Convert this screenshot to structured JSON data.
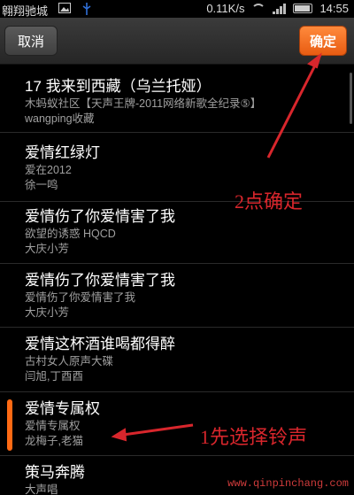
{
  "status_bar": {
    "carrier": "翱翔驰城",
    "speed": "0.11K/s",
    "time": "14:55"
  },
  "topbar": {
    "cancel_label": "取消",
    "confirm_label": "确定"
  },
  "list": {
    "items": [
      {
        "title": "17 我来到西藏（乌兰托娅）",
        "sub1": "木蚂蚁社区【天声王牌-2011网络新歌全纪录⑤】",
        "sub2": "wangping收藏"
      },
      {
        "title": "爱情红绿灯",
        "sub1": "爱在2012",
        "sub2": "徐一鸣"
      },
      {
        "title": "爱情伤了你爱情害了我",
        "sub1": "欲望的诱惑 HQCD",
        "sub2": "大庆小芳"
      },
      {
        "title": "爱情伤了你爱情害了我",
        "sub1": "爱情伤了你爱情害了我",
        "sub2": "大庆小芳"
      },
      {
        "title": "爱情这杯酒谁喝都得醉",
        "sub1": "古村女人原声大碟",
        "sub2": "闫旭,丁酉酉"
      },
      {
        "title": "爱情专属权",
        "sub1": "爱情专属权",
        "sub2": "龙梅子,老猫",
        "selected": true
      },
      {
        "title": "策马奔腾",
        "sub1": "大声唱",
        "sub2": ""
      }
    ]
  },
  "annotations": {
    "step2": "2点确定",
    "step1": "1先选择铃声",
    "watermark": "www.qinpinchang.com"
  },
  "colors": {
    "accent": "#ff6a14",
    "annotation_red": "#d8262c"
  },
  "icons": [
    "image-icon",
    "usb-icon",
    "wifi-icon",
    "signal-icon",
    "battery-icon"
  ]
}
